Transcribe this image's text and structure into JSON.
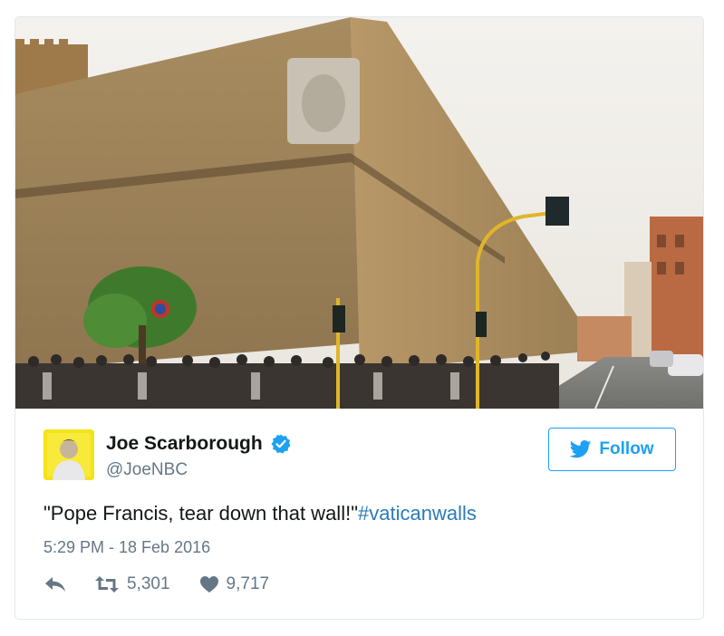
{
  "tweet": {
    "photo": {
      "description_icon": "photo-vatican-walls"
    },
    "author": {
      "display_name": "Joe Scarborough",
      "handle": "@JoeNBC",
      "verified": true
    },
    "follow_label": "Follow",
    "text_main": "\"Pope Francis, tear down that wall!\"",
    "text_hashtag": "#vaticanwalls",
    "timestamp": "5:29 PM - 18 Feb 2016",
    "retweets": "5,301",
    "likes": "9,717"
  },
  "colors": {
    "accent": "#1da1f2",
    "hashtag": "#2b7bb9",
    "muted": "#657786",
    "text": "#14171a",
    "border": "#e1e8ed"
  },
  "icons": [
    "twitter-bird-icon",
    "verified-badge-icon",
    "reply-icon",
    "retweet-icon",
    "heart-icon"
  ]
}
